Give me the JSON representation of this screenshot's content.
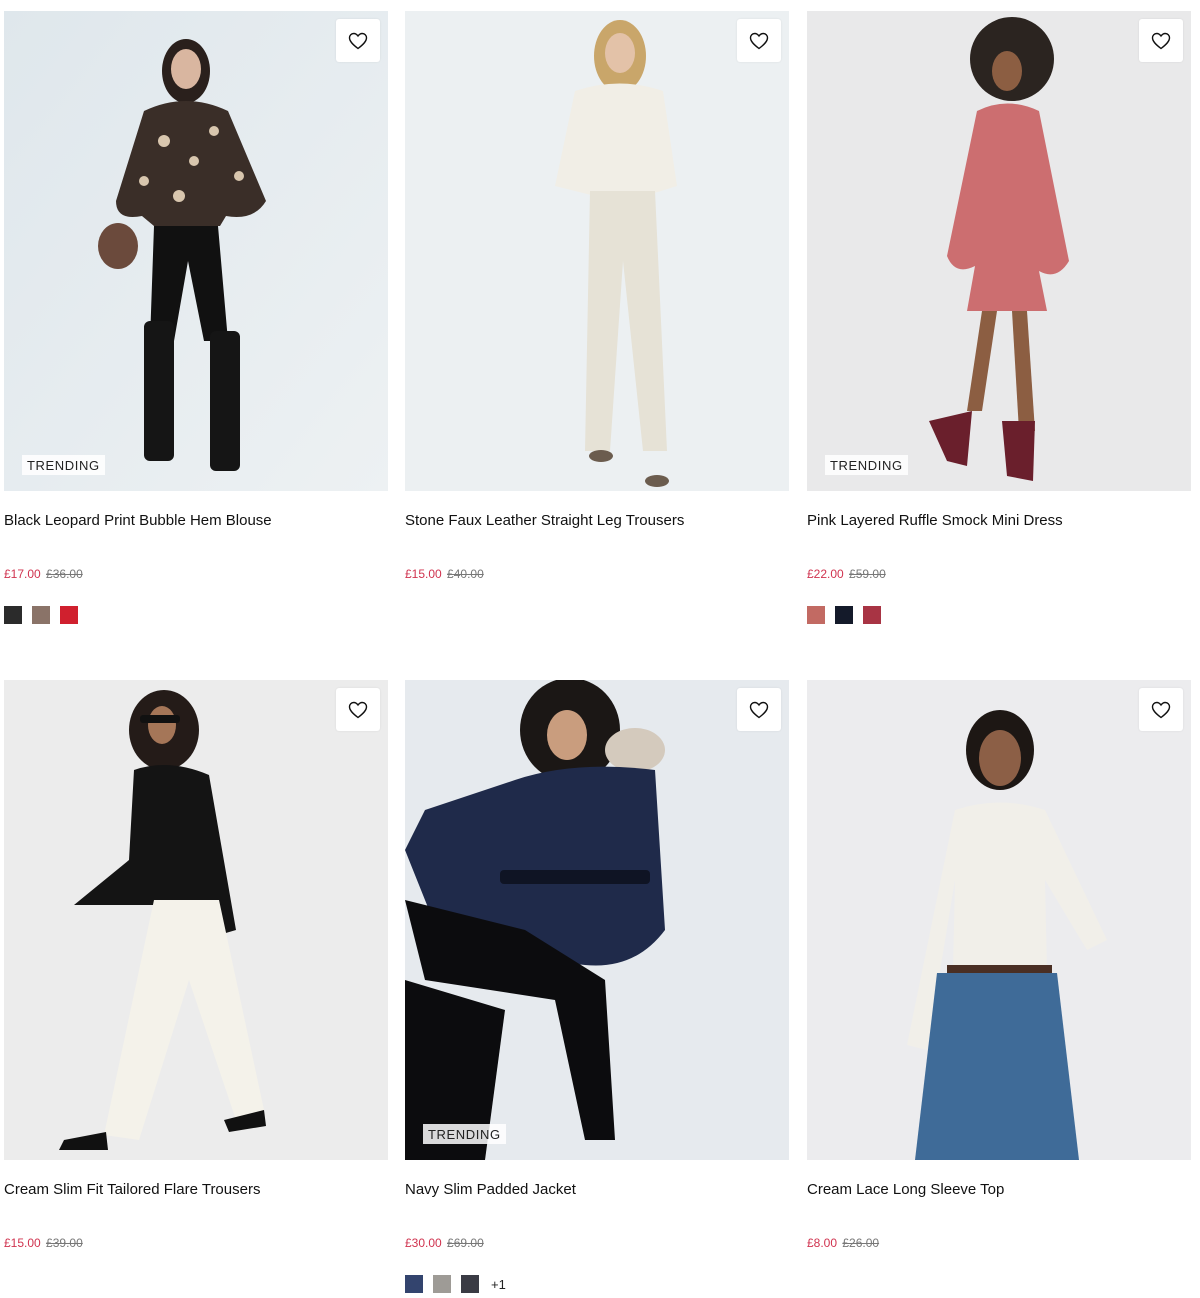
{
  "products": [
    {
      "name": "Black Leopard Print Bubble Hem Blouse",
      "price_now": "£17.00",
      "price_was": "£36.00",
      "badge": "TRENDING",
      "swatches": [
        "#2b2b2b",
        "#8a7368",
        "#d0202e"
      ],
      "more": ""
    },
    {
      "name": "Stone Faux Leather Straight Leg Trousers",
      "price_now": "£15.00",
      "price_was": "£40.00",
      "badge": "",
      "swatches": [],
      "more": ""
    },
    {
      "name": "Pink Layered Ruffle Smock Mini Dress",
      "price_now": "£22.00",
      "price_was": "£59.00",
      "badge": "TRENDING",
      "swatches": [
        "#c26a63",
        "#141a2a",
        "#a83444"
      ],
      "more": ""
    },
    {
      "name": "Cream Slim Fit Tailored Flare Trousers",
      "price_now": "£15.00",
      "price_was": "£39.00",
      "badge": "",
      "swatches": [],
      "more": ""
    },
    {
      "name": "Navy Slim Padded Jacket",
      "price_now": "£30.00",
      "price_was": "£69.00",
      "badge": "TRENDING",
      "swatches": [
        "#33446e",
        "#9e9b96",
        "#3a3b44"
      ],
      "more": "+1"
    },
    {
      "name": "Cream Lace Long Sleeve Top",
      "price_now": "£8.00",
      "price_was": "£26.00",
      "badge": "",
      "swatches": [],
      "more": ""
    }
  ]
}
